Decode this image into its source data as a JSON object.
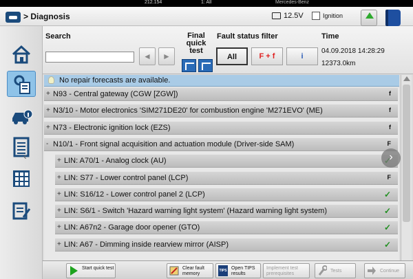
{
  "top_bar": {
    "left": "212.154",
    "mid": "1: All",
    "right": "Mercedes-Benz"
  },
  "header": {
    "title": "> Diagnosis",
    "voltage": "12.5V",
    "ignition_label": "Ignition",
    "ignition_checked": false
  },
  "filter": {
    "search_label": "Search",
    "search_value": "",
    "final_quick_test_label": "Final quick test",
    "fault_status_filter_label": "Fault status filter",
    "all_label": "All",
    "ff_label": "F + f",
    "info_label": "i",
    "time_label": "Time",
    "date_time": "04.09.2018 14:28:29",
    "odometer": "12373.0km"
  },
  "info_banner": "No repair forecasts are available.",
  "rows": [
    {
      "expander": "+",
      "text": "N93 - Central gateway (CGW [ZGW])",
      "status": "f",
      "indent": 0
    },
    {
      "expander": "+",
      "text": "N3/10 - Motor electronics 'SIM271DE20' for combustion engine 'M271EVO' (ME)",
      "status": "f",
      "indent": 0
    },
    {
      "expander": "+",
      "text": "N73 - Electronic ignition lock (EZS)",
      "status": "f",
      "indent": 0
    },
    {
      "expander": "-",
      "text": "N10/1 - Front signal acquisition and actuation module (Driver-side SAM)",
      "status": "F",
      "indent": 0
    },
    {
      "expander": "+",
      "text": "LIN: A70/1 - Analog clock (AU)",
      "status": "✓",
      "indent": 1
    },
    {
      "expander": "+",
      "text": "LIN: S77 - Lower control panel (LCP)",
      "status": "F",
      "indent": 1
    },
    {
      "expander": "+",
      "text": "LIN: S16/12 - Lower control panel 2 (LCP)",
      "status": "✓",
      "indent": 1
    },
    {
      "expander": "+",
      "text": "LIN: S6/1 - Switch 'Hazard warning light system' (Hazard warning light system)",
      "status": "✓",
      "indent": 1
    },
    {
      "expander": "+",
      "text": "LIN: A67n2 - Garage door opener (GTO)",
      "status": "✓",
      "indent": 1
    },
    {
      "expander": "+",
      "text": "LIN: A67 - Dimming inside rearview mirror (AISP)",
      "status": "✓",
      "indent": 1
    }
  ],
  "footer": {
    "start_quick_test": "Start quick test",
    "clear_fault_memory": "Clear fault memory",
    "open_tips_results": "Open TIPS results",
    "implement_test_prerequisites": "Implement test prerequisites",
    "tests": "Tests",
    "continue": "Continue",
    "tips_icon_text": "TIPS"
  },
  "sidebar": {
    "items": [
      "home-icon",
      "diagnosis-icon",
      "vehicle-info-icon",
      "list-icon",
      "control-units-icon",
      "documents-icon"
    ]
  },
  "colors": {
    "accent_blue": "#2a6bb7",
    "info_bg": "#a9cbe6",
    "ok_green": "#1f8f1f",
    "ff_red": "#e02020"
  }
}
